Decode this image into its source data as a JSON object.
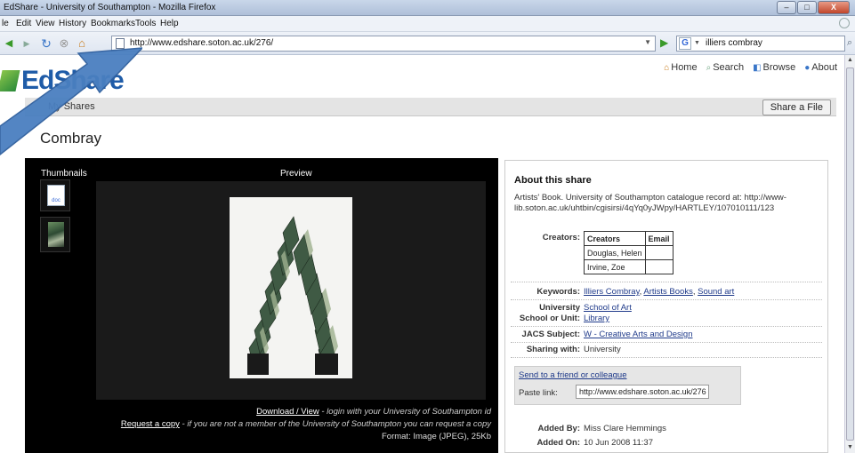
{
  "window": {
    "title": "EdShare - University of Southampton - Mozilla Firefox",
    "controls": {
      "minimize": "–",
      "maximize": "□",
      "close": "X"
    }
  },
  "menu": [
    "le",
    "Edit",
    "View",
    "History",
    "Bookmarks",
    "Tools",
    "Help"
  ],
  "nav": {
    "url": "http://www.edshare.soton.ac.uk/276/",
    "search_query": "illiers combray"
  },
  "site": {
    "logo": "EdShare",
    "top_links": {
      "home": "Home",
      "search": "Search",
      "browse": "Browse",
      "about": "About"
    },
    "my_shares": "My Shares",
    "share_button": "Share a File",
    "page_title": "Combray"
  },
  "panel": {
    "thumbnails_label": "Thumbnails",
    "preview_label": "Preview",
    "doc_icon_text": "doc",
    "download_link": "Download / View",
    "download_note": " - login with your University of Southampton id",
    "request_link": "Request a copy",
    "request_note": " - if you are not a member of the University of Southampton you can request a copy",
    "format": "Format: Image (JPEG), 25Kb"
  },
  "about": {
    "heading": "About this share",
    "description": "Artists' Book. University of Southampton catalogue record at: http://www-lib.soton.ac.uk/uhtbin/cgisirsi/4qYq0yJWpy/HARTLEY/107010111/123",
    "creators_label": "Creators:",
    "creators_table": {
      "headers": [
        "Creators",
        "Email"
      ],
      "rows": [
        [
          "Douglas, Helen",
          ""
        ],
        [
          "Irvine, Zoe",
          ""
        ]
      ]
    },
    "keywords_label": "Keywords:",
    "keywords": [
      "Illiers Combray",
      "Artists Books",
      "Sound art"
    ],
    "school_label_1": "University",
    "school_label_2": "School or Unit:",
    "school_values": [
      "School of Art",
      "Library"
    ],
    "jacs_label": "JACS Subject:",
    "jacs_value": "W - Creative Arts and Design",
    "sharing_label": "Sharing with:",
    "sharing_value": "University",
    "send_link": "Send to a friend or colleague",
    "paste_label": "Paste link:",
    "paste_value": "http://www.edshare.soton.ac.uk/276",
    "added_by_label": "Added By:",
    "added_by_value": "Miss Clare Hemmings",
    "added_on_label": "Added On:",
    "added_on_value": "10 Jun 2008 11:37"
  },
  "colors": {
    "brand_blue": "#1f5ca8",
    "arrow_blue": "#4a7fc0",
    "panel_black": "#000000"
  }
}
